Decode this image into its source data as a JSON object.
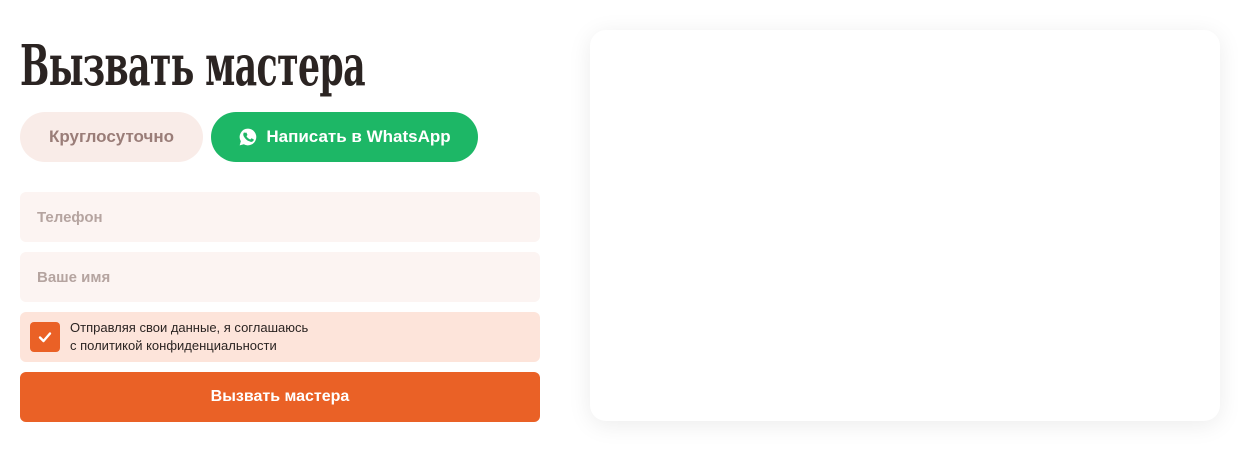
{
  "title": "Вызвать мастера",
  "pills": {
    "hours_label": "Круглосуточно",
    "whatsapp_label": "Написать в WhatsApp",
    "whatsapp_icon": "whatsapp-icon"
  },
  "form": {
    "phone_placeholder": "Телефон",
    "name_placeholder": "Ваше имя",
    "consent_line1": "Отправляя свои данные, я соглашаюсь",
    "consent_line2": "с политикой конфиденциальности",
    "consent_checked": true,
    "submit_label": "Вызвать мастера"
  },
  "colors": {
    "accent": "#ea6126",
    "whatsapp": "#1db766",
    "field_bg": "#fcf4f2",
    "consent_bg": "#fde4da"
  }
}
